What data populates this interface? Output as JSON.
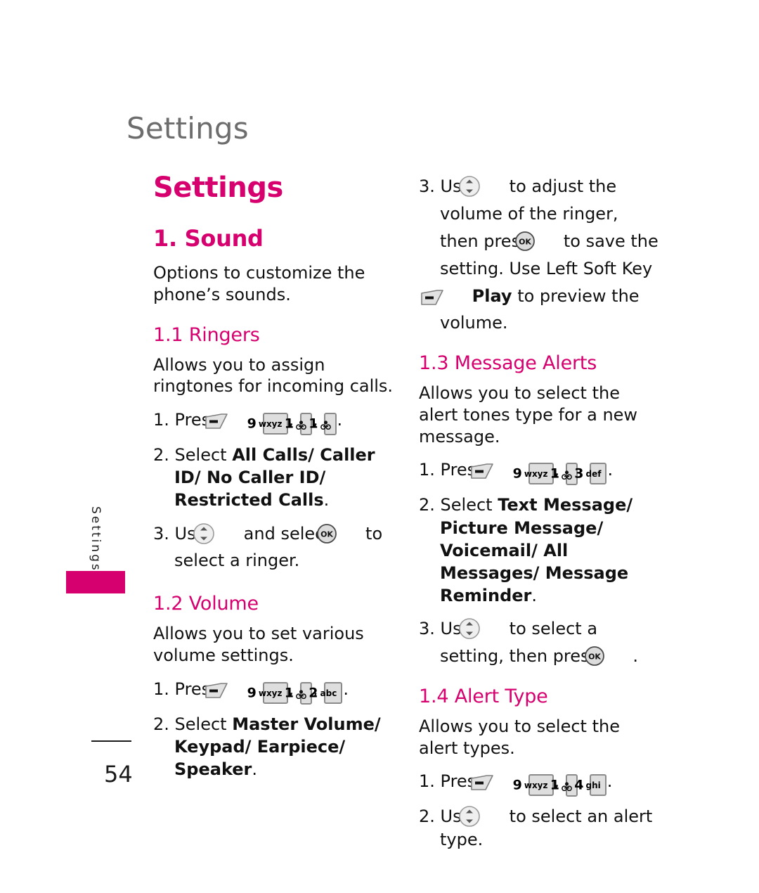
{
  "page": {
    "running_head": "Settings",
    "thumb_tab_label": "Settings",
    "folio": "54",
    "accent_color": "#d6006e",
    "running_head_color": "#6d6d6d",
    "body_color": "#111111"
  },
  "icons": {
    "soft_key": "soft-key-icon",
    "nav_key": "navigation-key-icon",
    "ok_key": "ok-key-icon",
    "key_9": "key-9-wxyz-icon",
    "key_1": "key-1-voicemail-icon",
    "key_2": "key-2-abc-icon",
    "key_3": "key-3-def-icon",
    "key_4": "key-4-ghi-icon"
  },
  "keys": {
    "k9": {
      "num": "9",
      "letters": "wxyz"
    },
    "k1": {
      "num": "1",
      "letters": ""
    },
    "k2": {
      "num": "2",
      "letters": "abc"
    },
    "k3": {
      "num": "3",
      "letters": "def"
    },
    "k4": {
      "num": "4",
      "letters": "ghi"
    }
  },
  "chapter": {
    "title": "Settings"
  },
  "section": {
    "title": "1. Sound",
    "intro": "Options to customize the phone’s sounds."
  },
  "subsections": {
    "ringers": {
      "title": "1.1 Ringers",
      "intro": "Allows you to assign ringtones for incoming calls.",
      "step1_prefix": "1. Press",
      "step2_prefix": "2. Select",
      "step2_bold": "All Calls/ Caller ID/ No Caller ID/ Restricted Calls",
      "step2_suffix": ".",
      "step3_a": "3. Use",
      "step3_b": "and select",
      "step3_c": "to select a ringer."
    },
    "volume": {
      "title": "1.2 Volume",
      "intro": "Allows you to set various volume settings.",
      "step1_prefix": "1. Press",
      "step2_prefix": "2. Select",
      "step2_bold": "Master Volume/ Keypad/ Earpiece/ Speaker",
      "step2_suffix": ".",
      "step3_a": "3. Use",
      "step3_b": "to adjust the volume of the ringer, then press",
      "step3_c": "to save the setting. Use Left Soft Key",
      "step3_bold": "Play",
      "step3_d": "to preview the volume."
    },
    "message_alerts": {
      "title": "1.3 Message Alerts",
      "intro": "Allows you to select the alert tones type for a new message.",
      "step1_prefix": "1. Press",
      "step2_prefix": "2. Select",
      "step2_bold": "Text Message/ Picture Message/ Voicemail/ All Messages/ Message Reminder",
      "step2_suffix": ".",
      "step3_a": "3. Use",
      "step3_b": "to select a setting, then press",
      "step3_c": "."
    },
    "alert_type": {
      "title": "1.4 Alert Type",
      "intro": "Allows you to select the alert types.",
      "step1_prefix": "1. Press",
      "step2_a": "2. Use",
      "step2_b": "to select an alert type."
    }
  }
}
